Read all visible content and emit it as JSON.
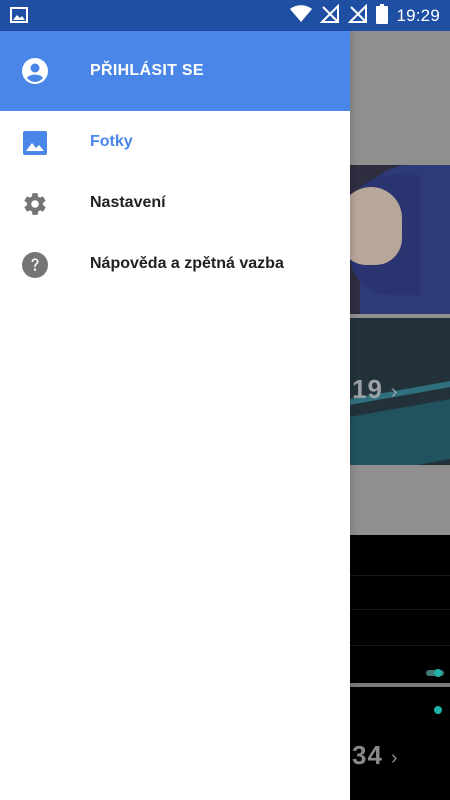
{
  "status_bar": {
    "time": "19:29",
    "left_icon": "image-notification-icon",
    "icons": [
      "wifi-icon",
      "no-signal-icon",
      "no-signal-icon",
      "battery-icon"
    ]
  },
  "drawer": {
    "header": {
      "label": "PŘIHLÁSIT SE",
      "icon": "account-circle-icon",
      "background": "#4a86e8"
    },
    "items": [
      {
        "label": "Fotky",
        "icon": "photo-icon",
        "active": true
      },
      {
        "label": "Nastavení",
        "icon": "gear-icon",
        "active": false
      },
      {
        "label": "Nápověda a zpětná vazba",
        "icon": "help-icon",
        "active": false
      }
    ]
  },
  "background": {
    "counter_1": "19",
    "counter_2": "34"
  },
  "colors": {
    "accent": "#4a86e8",
    "status_bar": "#1f4fa3",
    "text_primary": "#212121",
    "icon_gray": "#757575"
  }
}
